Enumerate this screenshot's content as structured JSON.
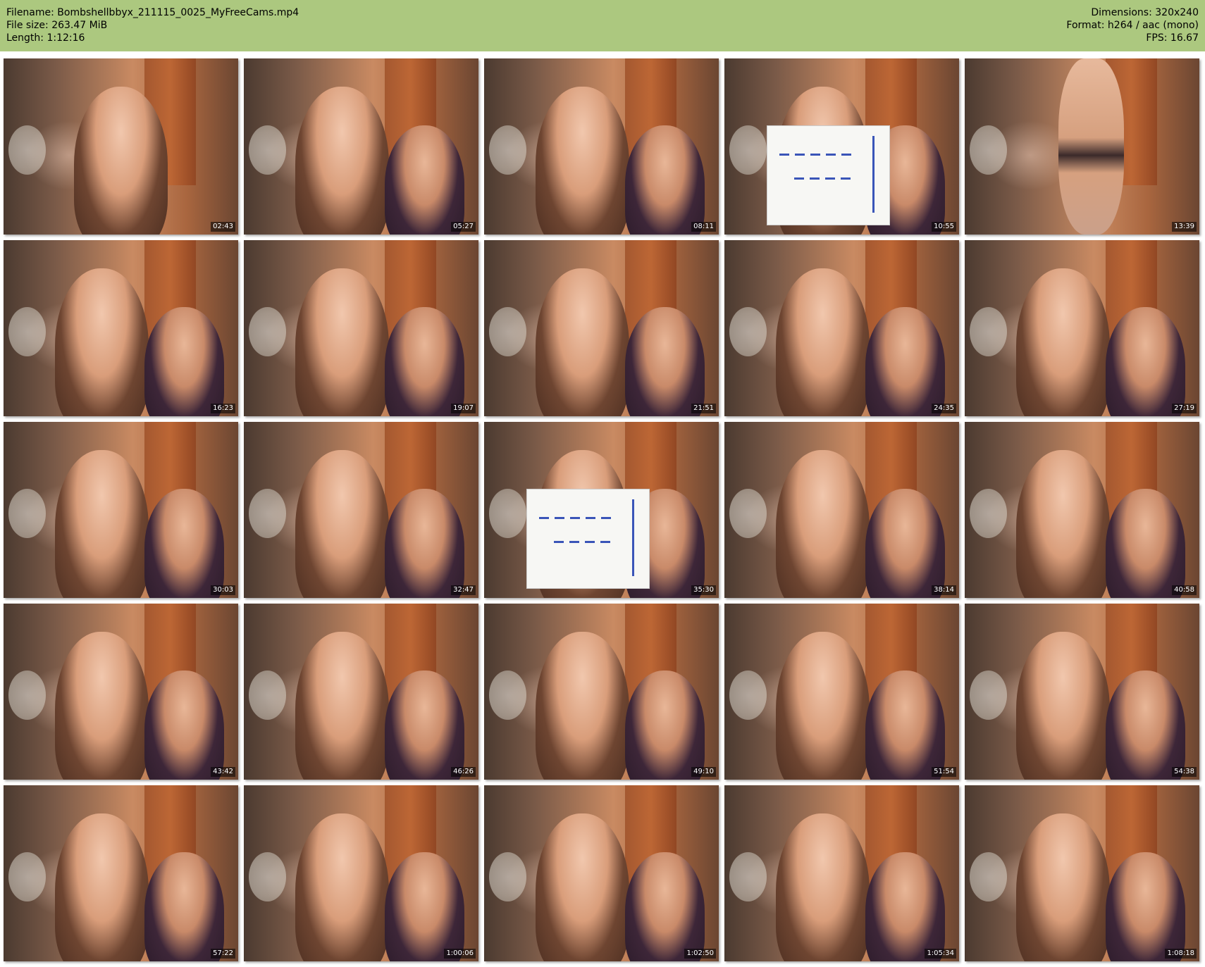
{
  "header": {
    "filename": "Filename: Bombshellbbyx_211115_0025_MyFreeCams.mp4",
    "filesize": "File size: 263.47 MiB",
    "length": "Length: 1:12:16",
    "dimensions": "Dimensions: 320x240",
    "format": "Format: h264 / aac (mono)",
    "fps": "FPS: 16.67",
    "background_color": "#acc87f"
  },
  "thumbnails": [
    {
      "time": "02:43",
      "variant": "solo"
    },
    {
      "time": "05:27",
      "variant": "duo"
    },
    {
      "time": "08:11",
      "variant": "duo"
    },
    {
      "time": "10:55",
      "variant": "sign"
    },
    {
      "time": "13:39",
      "variant": "dance"
    },
    {
      "time": "16:23",
      "variant": "duo"
    },
    {
      "time": "19:07",
      "variant": "duo"
    },
    {
      "time": "21:51",
      "variant": "duo"
    },
    {
      "time": "24:35",
      "variant": "duo"
    },
    {
      "time": "27:19",
      "variant": "duo"
    },
    {
      "time": "30:03",
      "variant": "duo"
    },
    {
      "time": "32:47",
      "variant": "duo"
    },
    {
      "time": "35:30",
      "variant": "sign"
    },
    {
      "time": "38:14",
      "variant": "duo"
    },
    {
      "time": "40:58",
      "variant": "duo"
    },
    {
      "time": "43:42",
      "variant": "duo"
    },
    {
      "time": "46:26",
      "variant": "duo"
    },
    {
      "time": "49:10",
      "variant": "duo"
    },
    {
      "time": "51:54",
      "variant": "duo"
    },
    {
      "time": "54:38",
      "variant": "duo"
    },
    {
      "time": "57:22",
      "variant": "duo"
    },
    {
      "time": "1:00:06",
      "variant": "duo"
    },
    {
      "time": "1:02:50",
      "variant": "duo"
    },
    {
      "time": "1:05:34",
      "variant": "duo"
    },
    {
      "time": "1:08:18",
      "variant": "duo"
    }
  ]
}
